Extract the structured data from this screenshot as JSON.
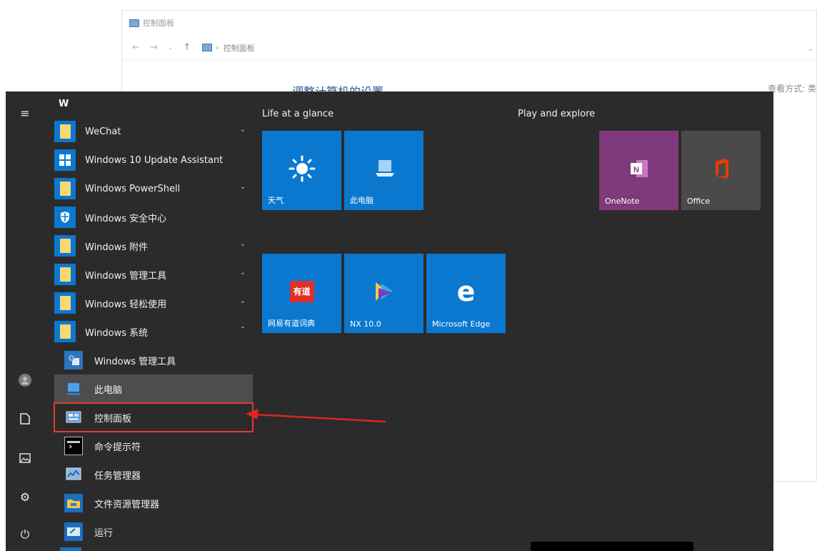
{
  "control_panel": {
    "window_title": "控制面板",
    "breadcrumb": "控制面板",
    "heading": "调整计算机的设置",
    "view_by": "查看方式:  类"
  },
  "start_menu": {
    "letter_header": "W",
    "apps": [
      {
        "label": "WeChat",
        "type": "folder",
        "chevron": "⌄"
      },
      {
        "label": "Windows 10 Update Assistant",
        "type": "windows-logo",
        "chevron": ""
      },
      {
        "label": "Windows PowerShell",
        "type": "folder",
        "chevron": "⌄"
      },
      {
        "label": "Windows 安全中心",
        "type": "shield",
        "chevron": ""
      },
      {
        "label": "Windows 附件",
        "type": "folder",
        "chevron": "⌄"
      },
      {
        "label": "Windows 管理工具",
        "type": "folder",
        "chevron": "⌄"
      },
      {
        "label": "Windows 轻松使用",
        "type": "folder",
        "chevron": "⌄"
      },
      {
        "label": "Windows 系统",
        "type": "folder",
        "chevron": "⌃"
      }
    ],
    "sub_apps": [
      {
        "label": "Windows 管理工具"
      },
      {
        "label": "此电脑"
      },
      {
        "label": "控制面板"
      },
      {
        "label": "命令提示符"
      },
      {
        "label": "任务管理器"
      },
      {
        "label": "文件资源管理器"
      },
      {
        "label": "运行"
      }
    ],
    "groups": [
      {
        "title": "Life at a glance"
      },
      {
        "title": "Play and explore"
      }
    ],
    "tiles": [
      {
        "label": "天气",
        "color": "#0b78d0"
      },
      {
        "label": "此电脑",
        "color": "#0b78d0"
      },
      {
        "label": "网易有道词典",
        "color": "#0b78d0"
      },
      {
        "label": "NX 10.0",
        "color": "#0b78d0"
      },
      {
        "label": "Microsoft Edge",
        "color": "#0b78d0"
      },
      {
        "label": "OneNote",
        "color": "#80397b"
      },
      {
        "label": "Office",
        "color": "#4a4a4a"
      }
    ],
    "youdao_badge": "有道"
  },
  "colors": {
    "accent": "#0b78d0",
    "menu_bg": "#2b2b2b",
    "highlight_box": "#e23a2e"
  }
}
